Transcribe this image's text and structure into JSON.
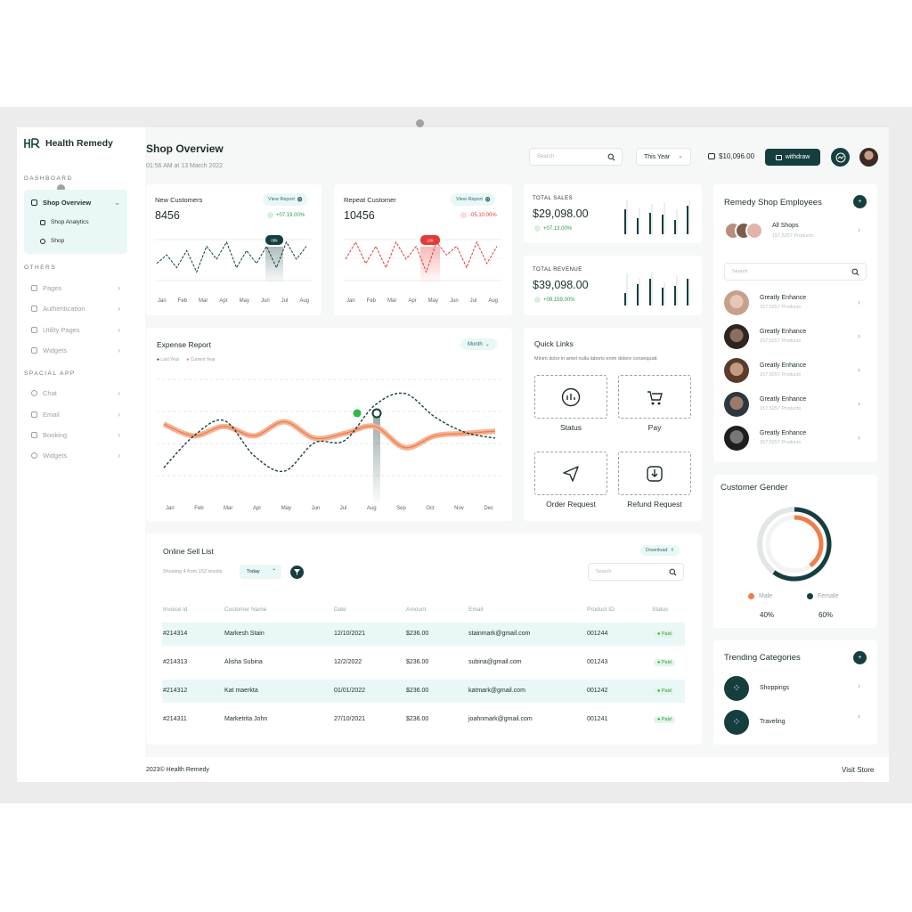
{
  "app": {
    "name": "Health Remedy"
  },
  "sidebar": {
    "sections": {
      "dashboard": "DASHBOARD",
      "others": "OTHERS",
      "special": "SPACIAL APP"
    },
    "active": "Shop Overview",
    "subitems": [
      "Shop Analytics",
      "Shop"
    ],
    "others": [
      "Pages",
      "Authentication",
      "Utility Pages",
      "Widgets"
    ],
    "special": [
      "Chat",
      "Email",
      "Booking",
      "Widgets"
    ]
  },
  "header": {
    "title": "Shop Overview",
    "timestamp": "01:56 AM at 13 March 2022",
    "search_placeholder": "Search",
    "period": "This Year",
    "balance": "$10,096.00",
    "withdraw": "withdraw"
  },
  "new_customers": {
    "title": "New Customers",
    "value": "8456",
    "report": "View Report",
    "delta": "+07.19.00%",
    "badge": "08k"
  },
  "repeat_customer": {
    "title": "Repeat Customer",
    "value": "10456",
    "report": "View Report",
    "delta": "-05.10.00%",
    "badge": "10k"
  },
  "months_short": [
    "Jan",
    "Feb",
    "Mar",
    "Apr",
    "May",
    "Jun",
    "Jul",
    "Aug"
  ],
  "total_sales": {
    "label": "TOTAL SALES",
    "value": "$29,098.00",
    "delta": "+07.13.00%"
  },
  "total_revenue": {
    "label": "TOTAL REVENUE",
    "value": "$39,098.00",
    "delta": "+09.159.00%"
  },
  "expense": {
    "title": "Expense Report",
    "period": "Month",
    "legend_last": "Last Year",
    "legend_current": "Current Year",
    "months": [
      "Jan",
      "Feb",
      "Mar",
      "Apr",
      "May",
      "Jun",
      "Jul",
      "Aug",
      "Sep",
      "Oct",
      "Nov",
      "Dec"
    ]
  },
  "quick_links": {
    "title": "Quick Links",
    "desc": "Minim dolor in amet nulla laboris enim dolore consequatt.",
    "items": [
      "Status",
      "Pay",
      "Order Request",
      "Refund Request"
    ]
  },
  "sell_list": {
    "title": "Online Sell List",
    "download": "Download",
    "showing": "Showing 4 from 152 results",
    "filter": "Today",
    "search_placeholder": "Search",
    "columns": [
      "Invoice id",
      "Customer Name",
      "Date",
      "Amount",
      "Email",
      "Product ID",
      "Status"
    ],
    "rows": [
      {
        "id": "#214314",
        "name": "Markesh Stain",
        "date": "12/10/2021",
        "amount": "$236.00",
        "email": "stainmark@gmail.com",
        "pid": "001244",
        "status": "Paid"
      },
      {
        "id": "#214313",
        "name": "Alisha Subina",
        "date": "12/2/2022",
        "amount": "$236.00",
        "email": "subina@gmail.com",
        "pid": "001243",
        "status": "Paid"
      },
      {
        "id": "#214312",
        "name": "Kat maerkta",
        "date": "01/01/2022",
        "amount": "$236.00",
        "email": "katmark@gmail.com",
        "pid": "001242",
        "status": "Paid"
      },
      {
        "id": "#214311",
        "name": "Marketrita John",
        "date": "27/10/2021",
        "amount": "$236.00",
        "email": "joahnmark@gmail.com",
        "pid": "001241",
        "status": "Paid"
      }
    ]
  },
  "employees": {
    "title": "Remedy Shop Employees",
    "all_shops": "All Shops",
    "all_shops_sub": "157,5257 Products",
    "search_placeholder": "Search",
    "list": [
      {
        "name": "Greatly Enhance",
        "sub": "157,5257 Products"
      },
      {
        "name": "Greatly Enhance",
        "sub": "157,5257 Products"
      },
      {
        "name": "Greatly Enhance",
        "sub": "157,5257 Products"
      },
      {
        "name": "Greatly Enhance",
        "sub": "157,5257 Products"
      },
      {
        "name": "Greatly Enhance",
        "sub": "157,5257 Products"
      }
    ]
  },
  "gender": {
    "title": "Customer Gender",
    "male": "Male",
    "female": "Female",
    "male_pct": "40%",
    "female_pct": "60%"
  },
  "trending": {
    "title": "Trending Categories",
    "items": [
      "Shoppings",
      "Traveling"
    ]
  },
  "footer": {
    "copyright": "2023© Health Remedy",
    "visit": "Visit Store"
  },
  "colors": {
    "accent": "#163e3f",
    "orange": "#f07d4a",
    "red": "#e53935",
    "mint": "#e9f7f6"
  },
  "chart_data": [
    {
      "type": "line",
      "title": "",
      "x": [
        "Jan",
        "Feb",
        "Mar",
        "Apr",
        "May",
        "Jun",
        "Jul",
        "Aug"
      ],
      "series": [
        {
          "values": [
            4,
            6,
            3,
            7,
            2,
            8,
            5,
            9,
            3,
            7,
            4,
            8,
            3,
            9,
            5,
            8
          ]
        }
      ]
    },
    {
      "type": "line",
      "title": "",
      "x": [
        "Jan",
        "Feb",
        "Mar",
        "Apr",
        "May",
        "Jun",
        "Jul",
        "Aug"
      ],
      "series": [
        {
          "values": [
            5,
            9,
            4,
            8,
            3,
            9,
            5,
            8,
            2,
            9,
            6,
            8,
            3,
            9,
            4,
            8
          ]
        }
      ]
    },
    {
      "type": "line",
      "title": "Expense Report",
      "x": [
        "Jan",
        "Feb",
        "Mar",
        "Apr",
        "May",
        "Jun",
        "Jul",
        "Aug",
        "Sep",
        "Oct",
        "Nov",
        "Dec"
      ],
      "series": [
        {
          "name": "Last Year",
          "values": [
            2.5,
            5.2,
            6.5,
            3.5,
            2.2,
            4.6,
            4.8,
            7.8,
            8.8,
            6.8,
            5.5,
            5.0
          ]
        },
        {
          "name": "Current Year",
          "values": [
            6.2,
            5.2,
            6.0,
            5.2,
            6.4,
            5.0,
            5.4,
            6.0,
            4.2,
            5.2,
            5.4,
            5.6
          ]
        }
      ]
    }
  ]
}
